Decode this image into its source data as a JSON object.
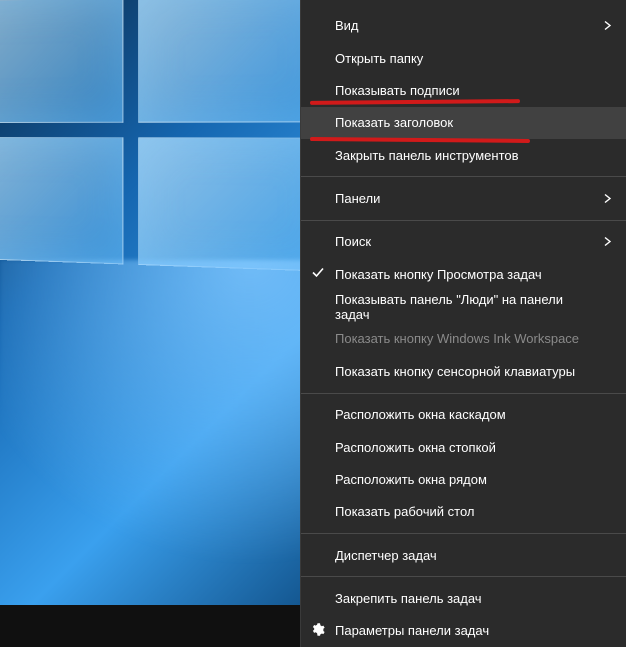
{
  "menu": {
    "items": [
      {
        "id": "view",
        "label": "Вид",
        "submenu": true,
        "disabled": false,
        "checked": false,
        "icon": null,
        "hovered": false
      },
      {
        "id": "open-folder",
        "label": "Открыть папку",
        "submenu": false,
        "disabled": false,
        "checked": false,
        "icon": null,
        "hovered": false
      },
      {
        "id": "show-captions",
        "label": "Показывать подписи",
        "submenu": false,
        "disabled": false,
        "checked": false,
        "icon": null,
        "hovered": false
      },
      {
        "id": "show-title",
        "label": "Показать заголовок",
        "submenu": false,
        "disabled": false,
        "checked": false,
        "icon": null,
        "hovered": true
      },
      {
        "id": "close-toolbar",
        "label": "Закрыть панель инструментов",
        "submenu": false,
        "disabled": false,
        "checked": false,
        "icon": null,
        "hovered": false
      },
      {
        "type": "separator"
      },
      {
        "id": "toolbars",
        "label": "Панели",
        "submenu": true,
        "disabled": false,
        "checked": false,
        "icon": null,
        "hovered": false
      },
      {
        "type": "separator"
      },
      {
        "id": "search",
        "label": "Поиск",
        "submenu": true,
        "disabled": false,
        "checked": false,
        "icon": null,
        "hovered": false
      },
      {
        "id": "task-view-btn",
        "label": "Показать кнопку Просмотра задач",
        "submenu": false,
        "disabled": false,
        "checked": true,
        "icon": null,
        "hovered": false
      },
      {
        "id": "people-bar",
        "label": "Показывать панель \"Люди\" на панели задач",
        "submenu": false,
        "disabled": false,
        "checked": false,
        "icon": null,
        "hovered": false
      },
      {
        "id": "ink-workspace",
        "label": "Показать кнопку Windows Ink Workspace",
        "submenu": false,
        "disabled": true,
        "checked": false,
        "icon": null,
        "hovered": false
      },
      {
        "id": "touch-keyboard",
        "label": "Показать кнопку сенсорной клавиатуры",
        "submenu": false,
        "disabled": false,
        "checked": false,
        "icon": null,
        "hovered": false
      },
      {
        "type": "separator"
      },
      {
        "id": "cascade",
        "label": "Расположить окна каскадом",
        "submenu": false,
        "disabled": false,
        "checked": false,
        "icon": null,
        "hovered": false
      },
      {
        "id": "stack",
        "label": "Расположить окна стопкой",
        "submenu": false,
        "disabled": false,
        "checked": false,
        "icon": null,
        "hovered": false
      },
      {
        "id": "side-by-side",
        "label": "Расположить окна рядом",
        "submenu": false,
        "disabled": false,
        "checked": false,
        "icon": null,
        "hovered": false
      },
      {
        "id": "show-desktop",
        "label": "Показать рабочий стол",
        "submenu": false,
        "disabled": false,
        "checked": false,
        "icon": null,
        "hovered": false
      },
      {
        "type": "separator"
      },
      {
        "id": "task-manager",
        "label": "Диспетчер задач",
        "submenu": false,
        "disabled": false,
        "checked": false,
        "icon": null,
        "hovered": false
      },
      {
        "type": "separator"
      },
      {
        "id": "lock-taskbar",
        "label": "Закрепить панель задач",
        "submenu": false,
        "disabled": false,
        "checked": false,
        "icon": null,
        "hovered": false
      },
      {
        "id": "taskbar-settings",
        "label": "Параметры панели задач",
        "submenu": false,
        "disabled": false,
        "checked": false,
        "icon": "gear",
        "hovered": false
      }
    ]
  },
  "annotations": {
    "underline_items": [
      "show-captions",
      "show-title"
    ]
  }
}
